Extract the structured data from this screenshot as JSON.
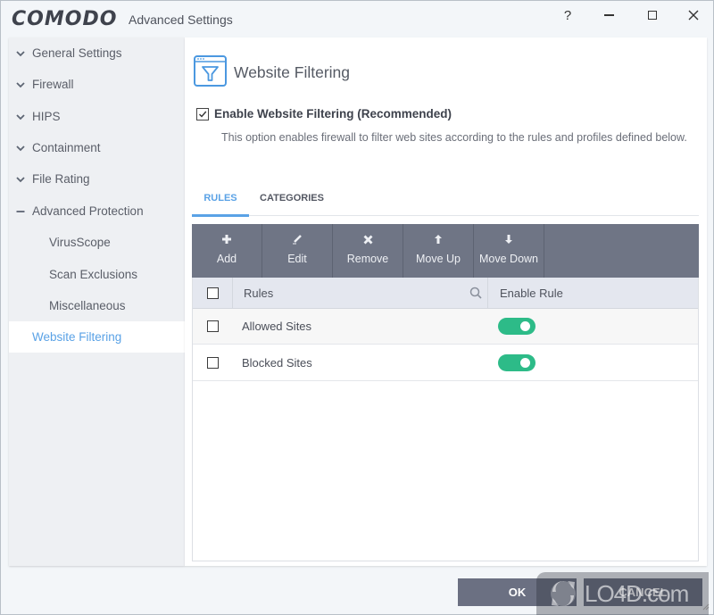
{
  "window": {
    "brand": "COMODO",
    "title": "Advanced Settings",
    "controls": {
      "help": "?"
    }
  },
  "sidebar": {
    "items": [
      {
        "label": "General Settings",
        "state": "collapsed"
      },
      {
        "label": "Firewall",
        "state": "collapsed"
      },
      {
        "label": "HIPS",
        "state": "collapsed"
      },
      {
        "label": "Containment",
        "state": "collapsed"
      },
      {
        "label": "File Rating",
        "state": "collapsed"
      },
      {
        "label": "Advanced Protection",
        "state": "expanded"
      },
      {
        "label": "VirusScope",
        "state": "child"
      },
      {
        "label": "Scan Exclusions",
        "state": "child"
      },
      {
        "label": "Miscellaneous",
        "state": "child"
      },
      {
        "label": "Website Filtering",
        "state": "active"
      }
    ]
  },
  "page": {
    "title": "Website Filtering",
    "icon": "browser-filter-icon",
    "enable_checkbox": {
      "label": "Enable Website Filtering (Recommended)",
      "checked": true
    },
    "description": "This option enables firewall to filter web sites according to the rules and profiles defined below.",
    "tabs": [
      {
        "label": "RULES",
        "active": true
      },
      {
        "label": "CATEGORIES",
        "active": false
      }
    ],
    "toolbar": [
      {
        "label": "Add",
        "icon": "plus-icon"
      },
      {
        "label": "Edit",
        "icon": "pencil-icon"
      },
      {
        "label": "Remove",
        "icon": "x-icon"
      },
      {
        "label": "Move Up",
        "icon": "arrow-up-icon"
      },
      {
        "label": "Move Down",
        "icon": "arrow-down-icon"
      }
    ],
    "grid": {
      "columns": [
        "Rules",
        "Enable Rule"
      ],
      "rows": [
        {
          "name": "Allowed Sites",
          "enabled": true,
          "selected": false
        },
        {
          "name": "Blocked Sites",
          "enabled": true,
          "selected": false
        }
      ]
    }
  },
  "footer": {
    "ok_label": "OK",
    "cancel_label": "CANCEL"
  },
  "watermark": {
    "text": "LO4D.com"
  },
  "colors": {
    "accent": "#5aa2e6",
    "toolbar": "#6f7585",
    "toggle_on": "#2dbb88",
    "button": "#6b7082"
  }
}
